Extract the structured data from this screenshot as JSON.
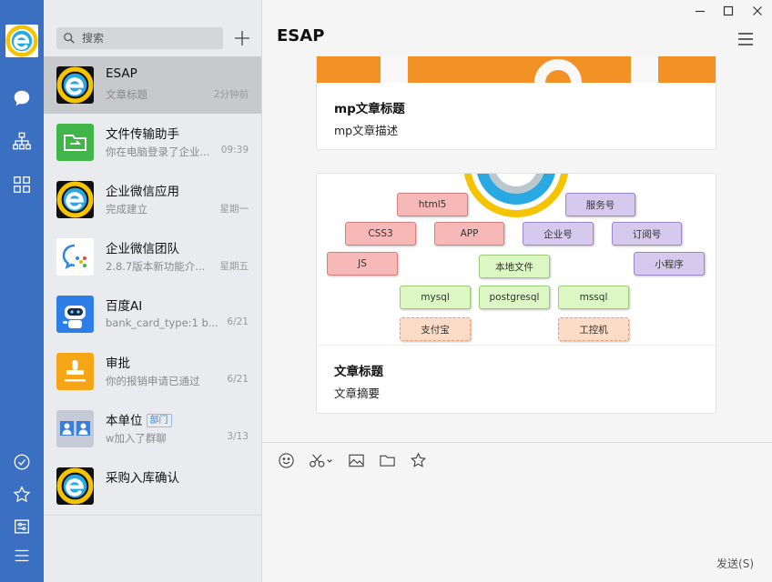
{
  "rail": {
    "icons": [
      "esap-logo",
      "chat-icon",
      "org-chart-icon",
      "apps-grid-icon",
      "check-circle-icon",
      "star-icon",
      "settings-sliders-icon",
      "menu-icon"
    ]
  },
  "search": {
    "placeholder": "搜索"
  },
  "conversations": [
    {
      "name": "ESAP",
      "preview": "文章标题",
      "time": "2分钟前",
      "avatar": "esap-logo"
    },
    {
      "name": "文件传输助手",
      "preview": "你在电脑登录了企业...",
      "time": "09:39",
      "avatar": "file-transfer-icon"
    },
    {
      "name": "企业微信应用",
      "preview": "完成建立",
      "time": "星期一",
      "avatar": "esap-logo"
    },
    {
      "name": "企业微信团队",
      "preview": "2.8.7版本新功能介...",
      "time": "星期五",
      "avatar": "wework-team-icon"
    },
    {
      "name": "百度AI",
      "preview": "bank_card_type:1 b...",
      "time": "6/21",
      "avatar": "robot-icon"
    },
    {
      "name": "审批",
      "preview": "你的报销申请已通过",
      "time": "6/21",
      "avatar": "stamp-icon"
    },
    {
      "name": "本单位",
      "tag": "部门",
      "preview": "w加入了群聊",
      "time": "3/13",
      "avatar": "group-icon"
    },
    {
      "name": "采购入库确认",
      "preview": "",
      "time": "",
      "avatar": "esap-logo"
    }
  ],
  "chat": {
    "title": "ESAP",
    "cards": [
      {
        "title": "mp文章标题",
        "desc": "mp文章描述"
      },
      {
        "title": "文章标题",
        "desc": "文章摘要"
      }
    ],
    "diagram_nodes": [
      "html5",
      "服务号",
      "CSS3",
      "APP",
      "企业号",
      "订阅号",
      "JS",
      "本地文件",
      "小程序",
      "mysql",
      "postgresql",
      "mssql",
      "支付宝",
      "工控机"
    ]
  },
  "composer": {
    "tools": [
      "emoji-icon",
      "scissors-icon",
      "image-icon",
      "folder-icon",
      "star-icon"
    ],
    "send_label": "发送(S)"
  },
  "colors": {
    "rail": "#3b6fc1",
    "banner": "#f29126",
    "active_row": "#c7c9cc"
  }
}
